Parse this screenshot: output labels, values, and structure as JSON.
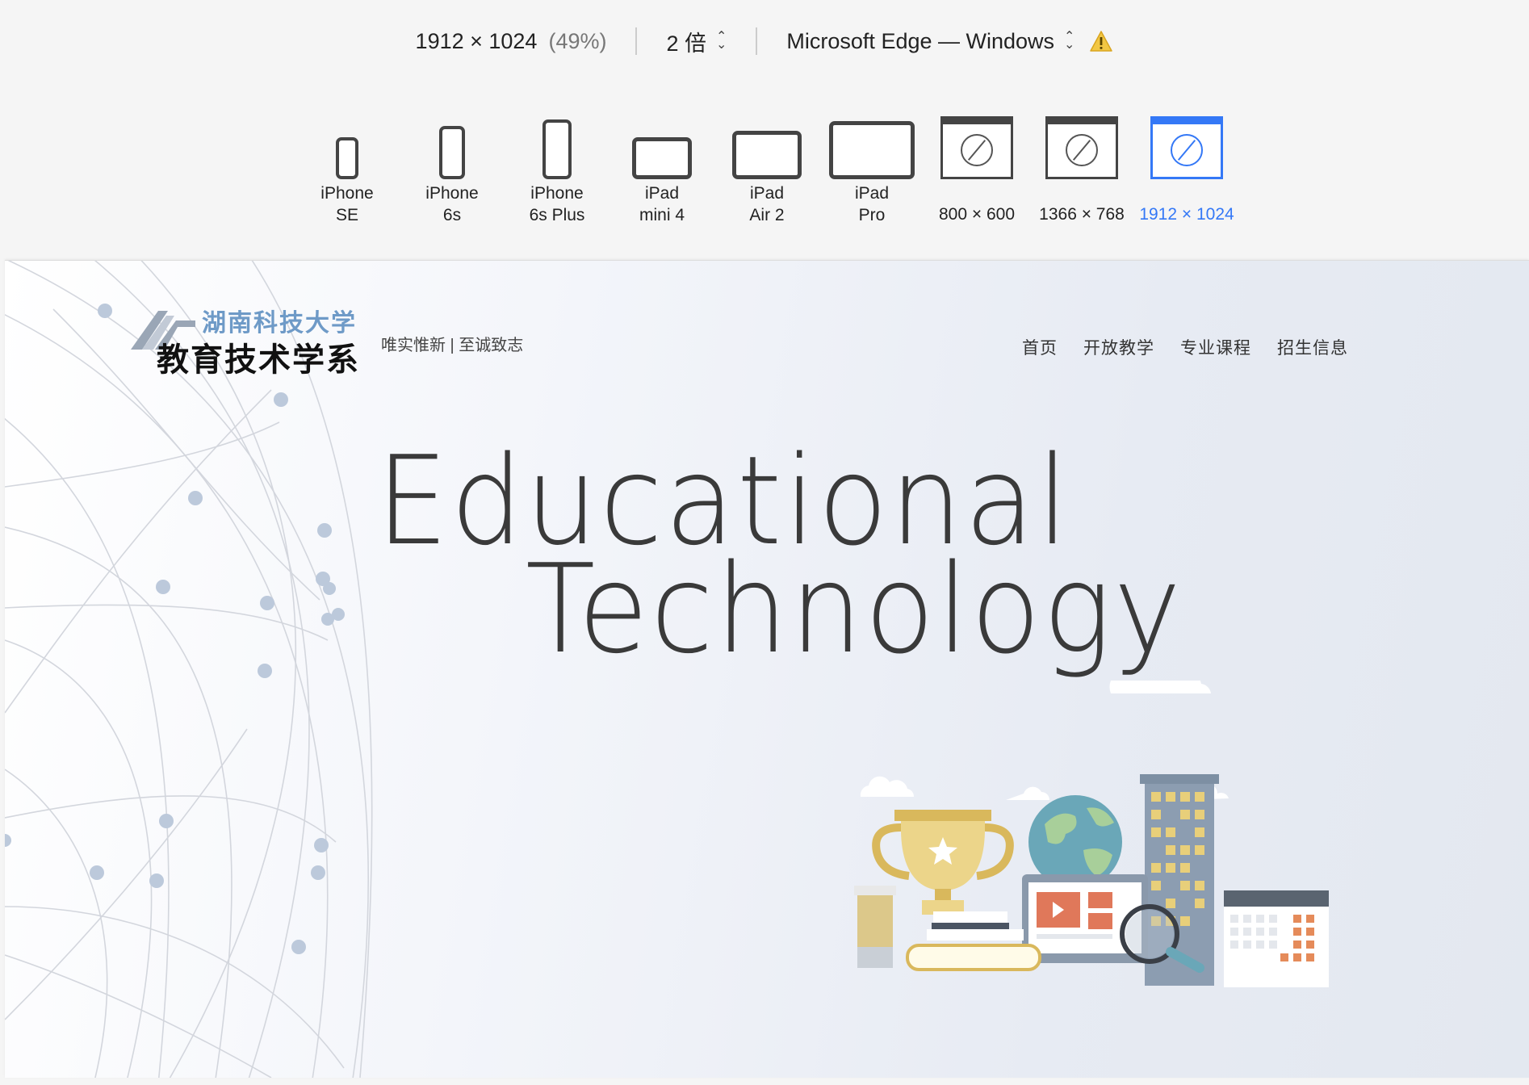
{
  "toolbar": {
    "viewport_size": "1912 × 1024",
    "zoom_percent": "(49%)",
    "scale": "2 倍",
    "browser": "Microsoft Edge — Windows",
    "devices": [
      {
        "line1": "iPhone",
        "line2": "SE"
      },
      {
        "line1": "iPhone",
        "line2": "6s"
      },
      {
        "line1": "iPhone",
        "line2": "6s Plus"
      },
      {
        "line1": "iPad",
        "line2": "mini 4"
      },
      {
        "line1": "iPad",
        "line2": "Air 2"
      },
      {
        "line1": "iPad",
        "line2": "Pro"
      },
      {
        "line1": "800 × 600"
      },
      {
        "line1": "1366 × 768"
      },
      {
        "line1": "1912 × 1024",
        "active": true
      }
    ],
    "accent_color": "#3478f6"
  },
  "site": {
    "logo_top": "湖南科技大学",
    "logo_main": "教育技术学系",
    "slogan": "唯实惟新 | 至诚致志",
    "nav": [
      "首页",
      "开放教学",
      "专业课程",
      "招生信息"
    ],
    "hero_line1": "Educational",
    "hero_line2": "Technology"
  }
}
